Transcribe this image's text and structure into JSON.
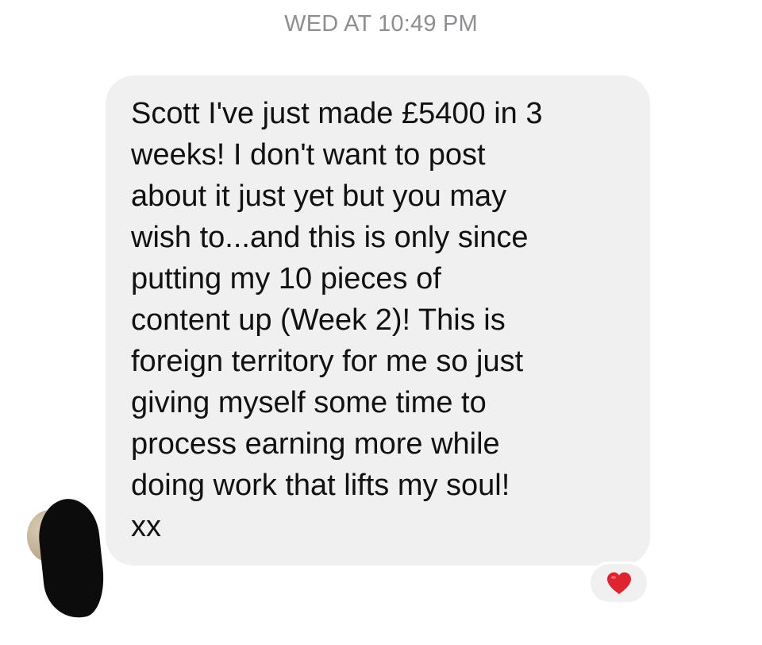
{
  "conversation": {
    "timestamp": "WED AT 10:49 PM",
    "message": {
      "text": "Scott I've just made £5400 in 3\nweeks! I don't want to post\nabout it just yet but you may\nwish to...and this is only since\nputting my 10 pieces of\ncontent up (Week 2)! This is\nforeign territory for me so just\ngiving myself some time to\nprocess earning more while\ndoing work that lifts my soul!\nxx",
      "reaction_icon": "red-heart-icon"
    }
  },
  "colors": {
    "bubble": "#f0f0f0",
    "timestamp": "#8e8e93",
    "heart": "#e0242f"
  }
}
